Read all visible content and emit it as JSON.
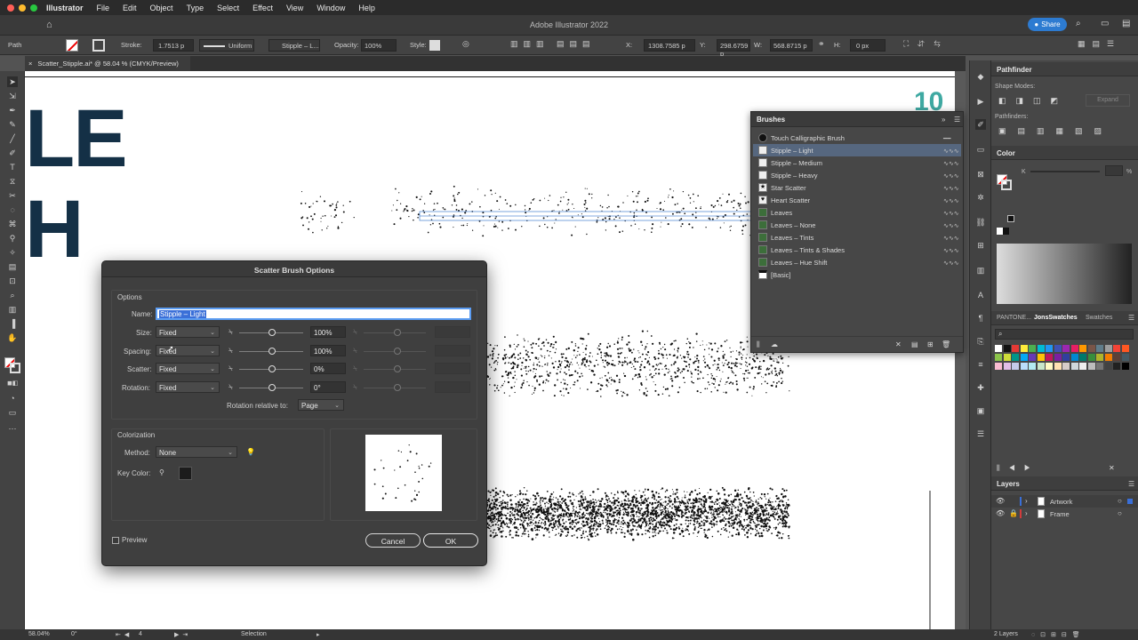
{
  "menubar": {
    "items": [
      "Illustrator",
      "File",
      "Edit",
      "Object",
      "Type",
      "Select",
      "Effect",
      "View",
      "Window",
      "Help"
    ]
  },
  "window": {
    "title": "Adobe Illustrator 2022",
    "share_label": "Share"
  },
  "control": {
    "object_type": "Path",
    "stroke_label": "Stroke:",
    "stroke_value": "1.7513 p",
    "profile": "Uniform",
    "brush": "Stipple – L...",
    "opacity_label": "Opacity:",
    "opacity_value": "100%",
    "style_label": "Style:",
    "x_label": "X:",
    "x_value": "1308.7585 p",
    "y_label": "Y:",
    "y_value": "298.6759 p",
    "w_label": "W:",
    "w_value": "568.8715 p",
    "h_label": "H:",
    "h_value": "0 px"
  },
  "document": {
    "tab_label": "Scatter_Stipple.ai* @ 58.04 % (CMYK/Preview)",
    "artwork_text_1": "LE",
    "artwork_text_2": "H",
    "page_number": "10"
  },
  "brushes_panel": {
    "title": "Brushes",
    "items": [
      {
        "name": "Touch Calligraphic Brush"
      },
      {
        "name": "Stipple – Light"
      },
      {
        "name": "Stipple – Medium"
      },
      {
        "name": "Stipple – Heavy"
      },
      {
        "name": "Star Scatter"
      },
      {
        "name": "Heart Scatter"
      },
      {
        "name": "Leaves"
      },
      {
        "name": "Leaves – None"
      },
      {
        "name": "Leaves – Tints"
      },
      {
        "name": "Leaves – Tints & Shades"
      },
      {
        "name": "Leaves – Hue Shift"
      },
      {
        "name": "[Basic]"
      }
    ],
    "selected_index": 1
  },
  "dialog": {
    "title": "Scatter Brush Options",
    "options_label": "Options",
    "name_label": "Name:",
    "name_value": "Stipple – Light",
    "size_label": "Size:",
    "size_mode": "Fixed",
    "size_value": "100%",
    "spacing_label": "Spacing:",
    "spacing_mode": "Fixed",
    "spacing_value": "100%",
    "scatter_label": "Scatter:",
    "scatter_mode": "Fixed",
    "scatter_value": "0%",
    "rotation_label": "Rotation:",
    "rotation_mode": "Fixed",
    "rotation_value": "0°",
    "rotation_relative_label": "Rotation relative to:",
    "rotation_relative_value": "Page",
    "colorization_label": "Colorization",
    "method_label": "Method:",
    "method_value": "None",
    "key_color_label": "Key Color:",
    "preview_label": "Preview",
    "cancel_label": "Cancel",
    "ok_label": "OK"
  },
  "pathfinder": {
    "title": "Pathfinder",
    "shape_modes_label": "Shape Modes:",
    "expand_label": "Expand",
    "pathfinders_label": "Pathfinders:"
  },
  "color_panel": {
    "title": "Color",
    "channel_label": "K",
    "percent_sign": "%"
  },
  "swatches_tabs": [
    "PANTONE...",
    "JonsSwatches",
    "Swatches"
  ],
  "layers": {
    "title": "Layers",
    "items": [
      {
        "name": "Artwork"
      },
      {
        "name": "Frame"
      }
    ],
    "count_label": "2 Layers"
  },
  "status": {
    "zoom": "58.04%",
    "rotation": "0°",
    "artboard": "4",
    "tool": "Selection"
  },
  "colors": {
    "accent": "#2d7bd1",
    "selection": "#56677f",
    "artwork_text": "#143046",
    "page_number": "#3fa9a2"
  }
}
